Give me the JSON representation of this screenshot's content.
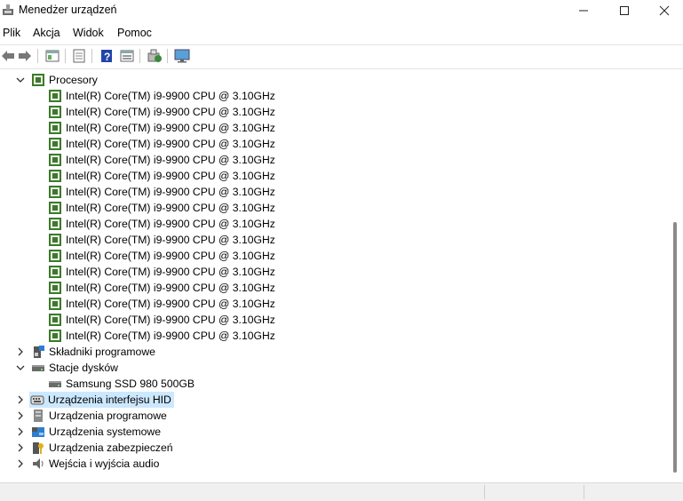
{
  "window": {
    "title": "Menedżer urządzeń"
  },
  "menu": [
    "Plik",
    "Akcja",
    "Widok",
    "Pomoc"
  ],
  "toolbar": [
    "back-icon",
    "forward-icon",
    "properties-icon",
    "update-driver-icon",
    "help-icon",
    "view-icon",
    "scan-hardware-icon",
    "monitor-icon"
  ],
  "tree": {
    "processors": {
      "label": "Procesory",
      "cpu": "Intel(R) Core(TM) i9-9900 CPU @ 3.10GHz"
    },
    "software_components": "Składniki programowe",
    "disk_drives": {
      "label": "Stacje dysków",
      "child": "Samsung SSD 980 500GB"
    },
    "hid": "Urządzenia interfejsu HID",
    "software_devices": "Urządzenia programowe",
    "system_devices": "Urządzenia systemowe",
    "security_devices": "Urządzenia zabezpieczeń",
    "audio_io": "Wejścia i wyjścia audio"
  },
  "colors": {
    "selection": "#cce8ff",
    "cpu_green": "#3b7a2c"
  }
}
